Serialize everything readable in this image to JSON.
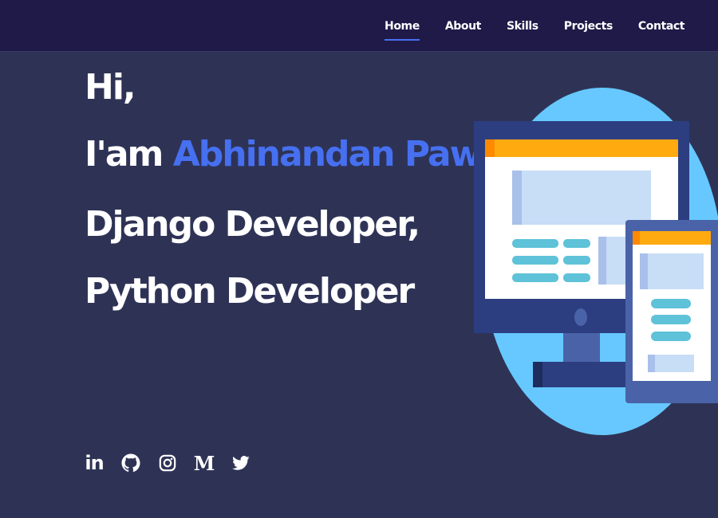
{
  "nav": {
    "items": [
      {
        "label": "Home",
        "active": true
      },
      {
        "label": "About",
        "active": false
      },
      {
        "label": "Skills",
        "active": false
      },
      {
        "label": "Projects",
        "active": false
      },
      {
        "label": "Contact",
        "active": false
      }
    ]
  },
  "hero": {
    "greeting": "Hi,",
    "intro_prefix": "I'am",
    "name": "Abhinandan Pawar",
    "role_1": "Django Developer,",
    "role_2": "Python Developer"
  },
  "social": [
    {
      "icon": "linkedin-icon",
      "label": "in"
    },
    {
      "icon": "github-icon"
    },
    {
      "icon": "instagram-icon"
    },
    {
      "icon": "medium-icon",
      "label": "M"
    },
    {
      "icon": "twitter-icon"
    }
  ],
  "colors": {
    "background": "#2e3356",
    "navbar": "#1f1a48",
    "accent": "#4670f0",
    "text": "#ffffff",
    "illustration_circle": "#66c8ff",
    "monitor_frame": "#2c3e80",
    "screen_header": "#ffab10",
    "screen_bars": "#5ec2d8"
  }
}
